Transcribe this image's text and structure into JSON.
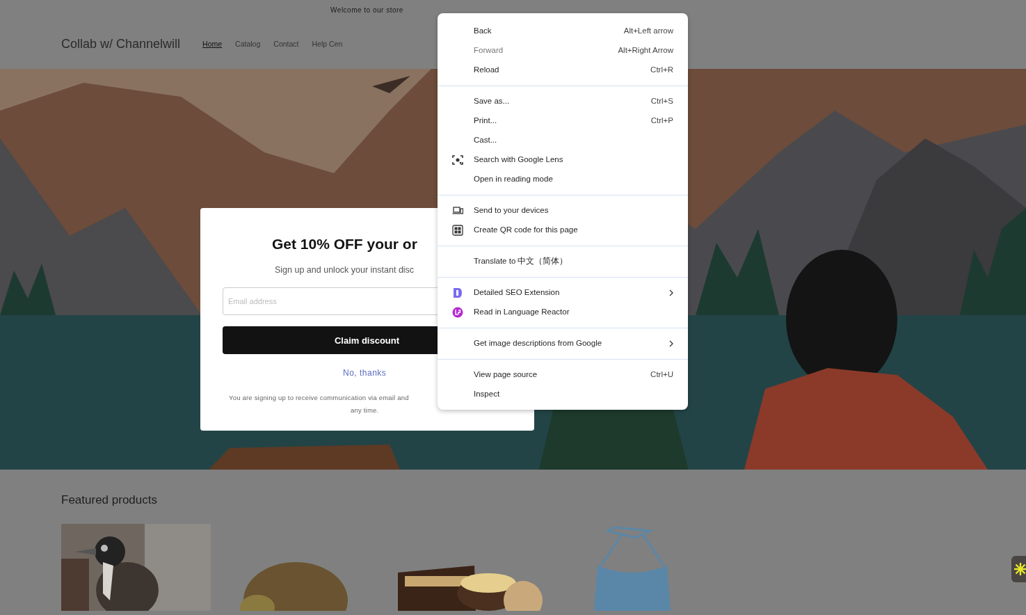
{
  "announcement": "Welcome to our store",
  "header": {
    "logo": "Collab w/ Channelwill",
    "nav": [
      {
        "label": "Home",
        "selected": true
      },
      {
        "label": "Catalog",
        "selected": false
      },
      {
        "label": "Contact",
        "selected": false
      },
      {
        "label": "Help Cen",
        "selected": false
      }
    ]
  },
  "popup": {
    "title": "Get 10% OFF your or",
    "subtitle": "Sign up and unlock your instant disc",
    "email": {
      "placeholder": "Email address"
    },
    "button": "Claim discount",
    "dismiss": "No, thanks",
    "legal": [
      "You are signing up to receive communication via email and",
      "any time."
    ]
  },
  "context_menu": {
    "groups": [
      [
        {
          "label": "Back",
          "shortcut": "Alt+Left arrow",
          "disabled": false
        },
        {
          "label": "Forward",
          "shortcut": "Alt+Right Arrow",
          "disabled": true
        },
        {
          "label": "Reload",
          "shortcut": "Ctrl+R",
          "disabled": false
        }
      ],
      [
        {
          "label": "Save as...",
          "shortcut": "Ctrl+S",
          "disabled": false
        },
        {
          "label": "Print...",
          "shortcut": "Ctrl+P",
          "disabled": false
        },
        {
          "label": "Cast...",
          "disabled": false
        },
        {
          "label": "Search with Google Lens",
          "kind": "lens",
          "disabled": false
        },
        {
          "label": "Open in reading mode",
          "disabled": false
        }
      ],
      [
        {
          "label": "Send to your devices",
          "kind": "devices",
          "disabled": false
        },
        {
          "label": "Create QR code for this page",
          "kind": "qr",
          "disabled": false
        }
      ],
      [
        {
          "label": "Translate to 中文（简体）",
          "disabled": false
        }
      ],
      [
        {
          "label": "Detailed SEO Extension",
          "kind": "seo",
          "disabled": false,
          "submenu": true
        },
        {
          "label": "Read in Language Reactor",
          "kind": "reactor",
          "disabled": false
        }
      ],
      [
        {
          "label": "Get image descriptions from Google",
          "disabled": false,
          "submenu": true
        }
      ],
      [
        {
          "label": "View page source",
          "shortcut": "Ctrl+U",
          "disabled": false
        },
        {
          "label": "Inspect",
          "disabled": false
        }
      ]
    ]
  },
  "featured": {
    "title": "Featured products",
    "products": [
      {
        "kind": "bird"
      },
      {
        "kind": "hedgehog"
      },
      {
        "kind": "jar"
      },
      {
        "kind": "top"
      }
    ]
  }
}
